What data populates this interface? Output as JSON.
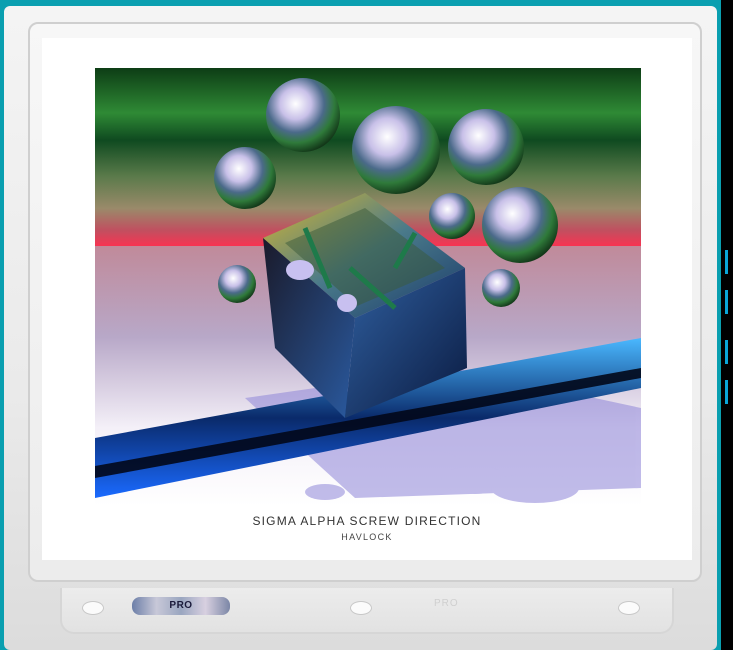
{
  "artwork": {
    "title": "SIGMA ALPHA SCREW DIRECTION",
    "artist": "HAVLOCK"
  },
  "sleeve": {
    "brand_sticker": "PRO",
    "embossed_text": "PRO"
  },
  "colors": {
    "frame": "#0a9fb0",
    "sky": "#1e6b2a",
    "horizon": "#e0405a",
    "floor_blue": "#1a8cff"
  }
}
